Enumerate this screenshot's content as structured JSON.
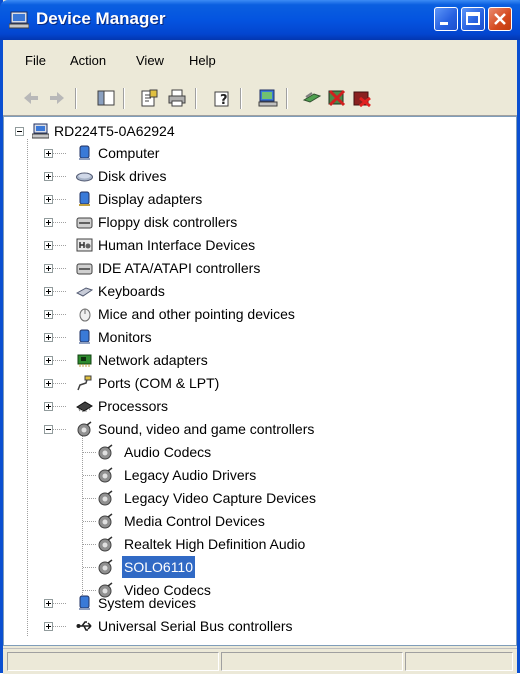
{
  "window": {
    "title": "Device Manager"
  },
  "menu": [
    "File",
    "Action",
    "View",
    "Help"
  ],
  "tree": {
    "root": "RD224T5-0A62924",
    "categories": [
      {
        "label": "Computer",
        "icon": "computer-icon"
      },
      {
        "label": "Disk drives",
        "icon": "disk-drive-icon"
      },
      {
        "label": "Display adapters",
        "icon": "display-adapter-icon"
      },
      {
        "label": "Floppy disk controllers",
        "icon": "floppy-controller-icon"
      },
      {
        "label": "Human Interface Devices",
        "icon": "hid-icon"
      },
      {
        "label": "IDE ATA/ATAPI controllers",
        "icon": "ide-controller-icon"
      },
      {
        "label": "Keyboards",
        "icon": "keyboard-icon"
      },
      {
        "label": "Mice and other pointing devices",
        "icon": "mouse-icon"
      },
      {
        "label": "Monitors",
        "icon": "monitor-icon"
      },
      {
        "label": "Network adapters",
        "icon": "network-adapter-icon"
      },
      {
        "label": "Ports (COM & LPT)",
        "icon": "port-icon"
      },
      {
        "label": "Processors",
        "icon": "processor-icon"
      },
      {
        "label": "Sound, video and game controllers",
        "icon": "sound-icon",
        "expanded": true
      },
      {
        "label": "System devices",
        "icon": "system-device-icon"
      },
      {
        "label": "Universal Serial Bus controllers",
        "icon": "usb-icon"
      }
    ],
    "sound_children": [
      "Audio Codecs",
      "Legacy Audio Drivers",
      "Legacy Video Capture Devices",
      "Media Control Devices",
      "Realtek High Definition Audio",
      "SOLO6110",
      "Video Codecs"
    ],
    "selected": "SOLO6110"
  },
  "colors": {
    "titlebar": "#0454e0",
    "selection": "#316ac5",
    "window_bg": "#ece9d8"
  }
}
